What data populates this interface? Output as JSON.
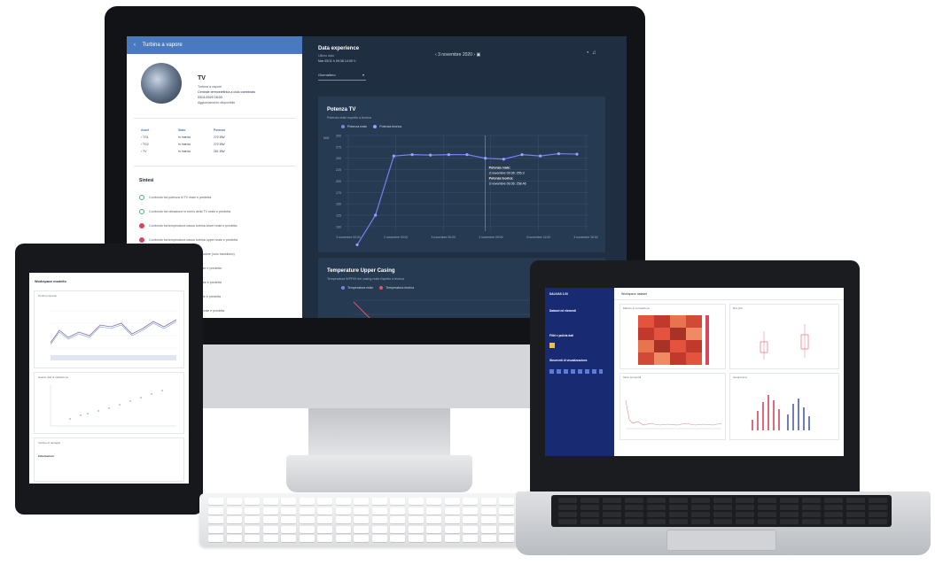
{
  "imac": {
    "left_panel": {
      "header_title": "Turbina a vapore",
      "asset_title": "TV",
      "asset_lines": [
        "Turbina a vapore",
        "Centrale termoelettrica a ciclo combinato",
        "03/11/2020 18:00",
        "Aggiornamento disponibile"
      ],
      "table_headers": [
        "Asset",
        "Stato",
        "Potenza"
      ],
      "table_rows": [
        [
          "TG1",
          "In marcia",
          "270 MW"
        ],
        [
          "TG2",
          "In marcia",
          "270 MW"
        ],
        [
          "TV",
          "In marcia",
          "261 MW"
        ]
      ],
      "section_title": "Sintesi",
      "summary_items": [
        {
          "text": "Confronto tra potenza di TV reale e predetta",
          "status": "ok"
        },
        {
          "text": "Confronto tra vibrazione in mm/s della TV reale e predetta",
          "status": "ok"
        },
        {
          "text": "Confronto tra temperatura cassa turbina lower reale e predetta",
          "status": "err"
        },
        {
          "text": "Confronto tra temperatura cassa turbina upper reale e predetta",
          "status": "err"
        },
        {
          "text": "Confronto tra livelli di vuoto al condensatore (solo transitorio)",
          "status": "ok"
        },
        {
          "text": "Confronto tra pressione vapore HP reale e predetta",
          "status": "ok"
        },
        {
          "text": "Confronto tra pressione vapore RH reale e predetta",
          "status": "ok"
        },
        {
          "text": "Confronto tra pressione vapore LP reale e predetta",
          "status": "ok"
        },
        {
          "text": "Confronto tra temperatura vapore HP reale e predetta",
          "status": "ok"
        }
      ]
    },
    "right_panel": {
      "title": "Data experience",
      "subtitle": "Ultimo dato",
      "last_update": "Mar 03/11 h 09:38 14:00",
      "select_label": "Giornaliero",
      "date_nav": "3 novembre 2020",
      "card1": {
        "title": "Potenza TV",
        "subtitle": "Potenza reale rispetto a teorica",
        "legend": [
          "Potenza reale",
          "Potenza teorica"
        ],
        "tooltip": [
          "Potenza reale:",
          "3 novembre 09:36: 255.3",
          "Potenza teorica:",
          "3 novembre 09:36: 258.46"
        ]
      },
      "card2": {
        "title": "Temperature Upper Casing",
        "subtitle": "Temperatura WPF05 del casing reale rispetto a teorica",
        "legend": [
          "Temperatura reale",
          "Temperatura teorica"
        ]
      }
    }
  },
  "chart_data": [
    {
      "type": "line",
      "title": "Potenza TV",
      "subtitle": "Potenza reale rispetto a teorica",
      "x": [
        "3 novembre 00:00",
        "3 novembre 03:00",
        "3 novembre 06:00",
        "3 novembre 09:00",
        "3 novembre 12:00",
        "3 novembre 15:00"
      ],
      "series": [
        {
          "name": "Potenza reale",
          "values": [
            60,
            125,
            255,
            258,
            257,
            258,
            258,
            250,
            248,
            258,
            255,
            260,
            259
          ],
          "color": "#7b7ff2"
        },
        {
          "name": "Potenza teorica",
          "values": [
            60,
            125,
            255,
            258,
            257,
            258,
            258,
            250,
            248,
            258,
            255,
            260,
            259
          ],
          "color": "#9aa0ff"
        }
      ],
      "yticks": [
        "300",
        "275",
        "250",
        "225",
        "200",
        "175",
        "150",
        "125",
        "100"
      ],
      "ylabel": "MW",
      "ylim": [
        90,
        300
      ]
    }
  ],
  "tablet": {
    "title": "Workspace modello",
    "card1_title": "Profili temporali",
    "card2_title": "Scatter dati di validazione",
    "card3_title": "Verifica di dettaglio",
    "card3_section": "Informazioni"
  },
  "laptop": {
    "app_title": "DALIVAS 1.00",
    "workspace": "Workspace dataset",
    "sidebar_sections": [
      "Dataset ed elementi",
      "Filtri e pulizia dati",
      "Strumenti di visualizzazione"
    ],
    "card_titles": [
      "Matrice di correlazione",
      "Box plot",
      "Serie temporali",
      "Istogramma"
    ]
  },
  "colors": {
    "accent": "#4a79c0",
    "dark_panel": "#1f2e40",
    "card": "#263a52",
    "sidebar_blue": "#182a72",
    "ok": "#4bb070",
    "error": "#d9465b",
    "line": "#7b7ff2"
  }
}
